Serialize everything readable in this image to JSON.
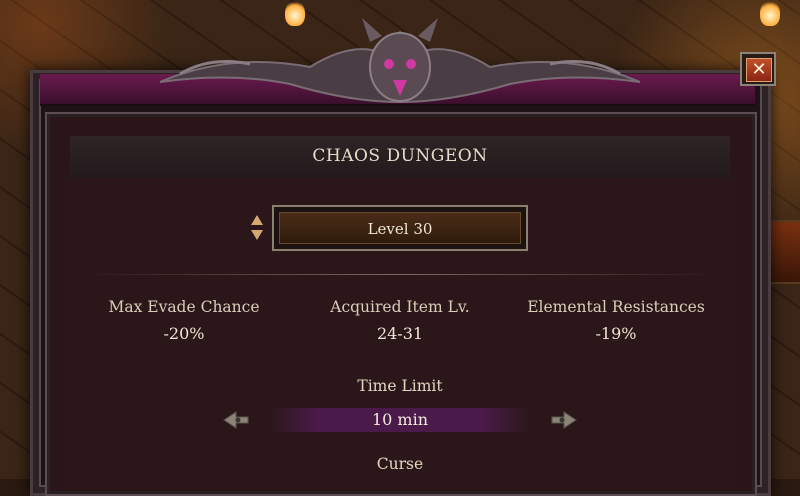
{
  "dialog": {
    "title": "CHAOS DUNGEON",
    "close_label": "✕"
  },
  "level": {
    "label": "Level 30"
  },
  "stats": [
    {
      "label": "Max Evade Chance",
      "value": "-20%"
    },
    {
      "label": "Acquired Item Lv.",
      "value": "24-31"
    },
    {
      "label": "Elemental Resistances",
      "value": "-19%"
    }
  ],
  "time_limit": {
    "label": "Time Limit",
    "value": "10 min"
  },
  "curse": {
    "label": "Curse"
  },
  "colors": {
    "accent_magenta": "#6a1a4e",
    "close_button": "#b0421f",
    "panel_bg": "#2b1719"
  },
  "icons": [
    "close-icon",
    "stepper-up-icon",
    "stepper-down-icon",
    "arrow-left-icon",
    "arrow-right-icon",
    "skull-ornament-icon"
  ]
}
